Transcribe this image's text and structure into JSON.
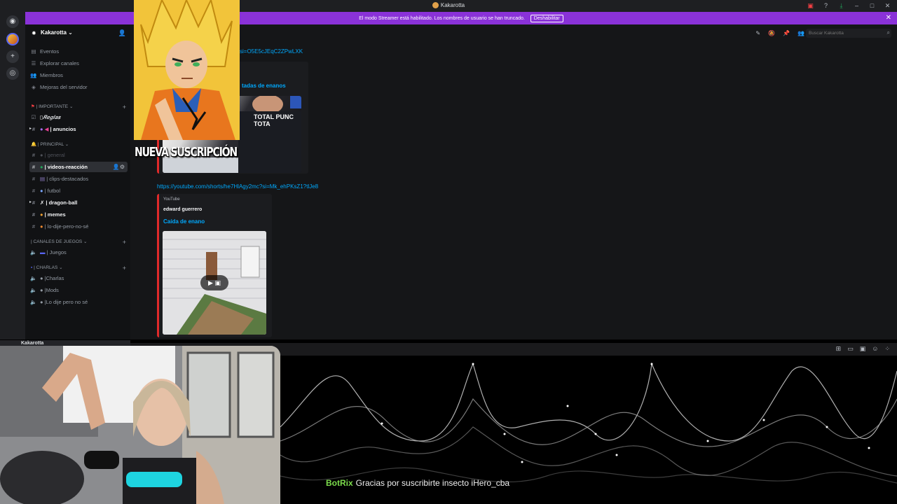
{
  "window": {
    "title": "Kakarotta"
  },
  "banner": {
    "text": "El modo Streamer está habilitado. Los nombres de usuario se han truncado.",
    "button": "Deshabilitar"
  },
  "server": {
    "name": "Kakarotta ⌄"
  },
  "sidebar": {
    "top_items": [
      "Eventos",
      "Explorar canales",
      "Miembros",
      "Mejoras del servidor"
    ],
    "categories": {
      "importante": "| IMPORTANTE ⌄",
      "principal": "| PRINCIPAL ⌄",
      "juegos": "| CANALES DE JUEGOS ⌄",
      "charlas": "| CHARLAS ⌄"
    },
    "channels": {
      "reglas": "𝑹𝒆𝒈𝒍𝒂𝒔",
      "anuncios": "| anuncios",
      "general": "| general",
      "videos": "| videos-reacción",
      "clips": "| clips-destacados",
      "futbol": "| futbol",
      "dragon": "| dragon-ball",
      "memes": "| memes",
      "lodije": "| lo-dije-pero-no-sé",
      "juegos": "| Juegos",
      "charlas": "|Charlas",
      "mods": "|Mods",
      "lodije_voice": "|Lo dije pero no sé"
    }
  },
  "chat": {
    "search_placeholder": "Buscar Kakarotta",
    "link1": "si=O5E5cJEqC2ZPwLXK",
    "embed1_title_fragment": "tadas de enanos",
    "link2": "https://youtube.com/shorts/he7HlAgy2mc?si=Mk_ehPKsZ1?tlJe8",
    "embed2": {
      "provider": "YouTube",
      "author": "edward guerrero",
      "title": "Caída de enano"
    },
    "fight_jersey": "TOTAL PUNC TOTA"
  },
  "overlay": {
    "subscription": "NUEVA SUSCRIPCIÓN"
  },
  "stream": {
    "user_strip": "Kakarotta",
    "chat_user": "BotRix",
    "chat_message": "Gracias por suscribirte insecto iHero_cba"
  },
  "colors": {
    "banner": "#8a32d8",
    "link": "#00a8fc",
    "embed_border": "#e02a2a",
    "botrix": "#7cdc4c"
  }
}
